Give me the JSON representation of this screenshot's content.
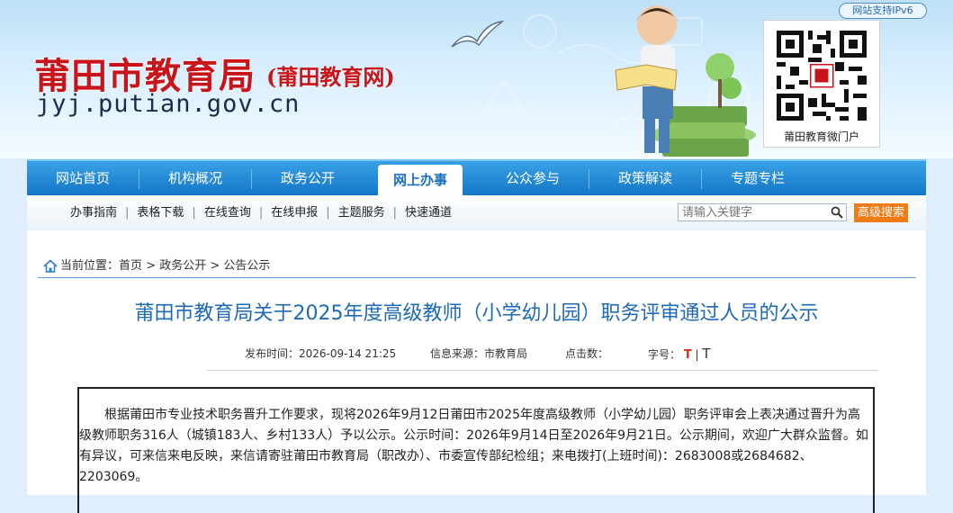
{
  "header": {
    "ipv6_badge": "网站支持IPv6",
    "site_title": "莆田市教育局",
    "site_subtitle": "(莆田教育网)",
    "site_url": "jyj.putian.gov.cn",
    "qr_label": "莆田教育微门户"
  },
  "main_nav": [
    {
      "label": "网站首页"
    },
    {
      "label": "机构概况"
    },
    {
      "label": "政务公开"
    },
    {
      "label": "网上办事"
    },
    {
      "label": "公众参与"
    },
    {
      "label": "政策解读"
    },
    {
      "label": "专题专栏"
    }
  ],
  "sub_nav": {
    "links": [
      "办事指南",
      "表格下载",
      "在线查询",
      "在线申报",
      "主题服务",
      "快速通道"
    ],
    "separator": "|",
    "search_placeholder": "请输入关键字",
    "advanced_search_label": "高级搜索"
  },
  "breadcrumb": {
    "prefix": "当前位置：",
    "items": [
      "首页",
      "政务公开",
      "公告公示"
    ],
    "separator": " > "
  },
  "article": {
    "title": "莆田市教育局关于2025年度高级教师（小学幼儿园）职务评审通过人员的公示",
    "publish_time": "发布时间：2026-09-14 21:25",
    "source": "信息来源：市教育局",
    "clicks": "点击数：",
    "font_size_label": "字号：",
    "font_big": "T",
    "font_separator": "|",
    "font_small": "T",
    "body": "根据莆田市专业技术职务晋升工作要求，现将2026年9月12日莆田市2025年度高级教师（小学幼儿园）职务评审会上表决通过晋升为高级教师职务316人（城镇183人、乡村133人）予以公示。公示时间：2026年9月14日至2026年9月21日。公示期间，欢迎广大群众监督。如有异议，可来信来电反映，来信请寄驻莆田市教育局（职改办）、市委宣传部纪检组；来电拨打(上班时间)：2683008或2684682、2203069。"
  },
  "colors": {
    "brand_red": "#c8141b",
    "nav_blue": "#1273c5",
    "title_blue": "#1e6ab8",
    "search_orange": "#f07a14"
  }
}
